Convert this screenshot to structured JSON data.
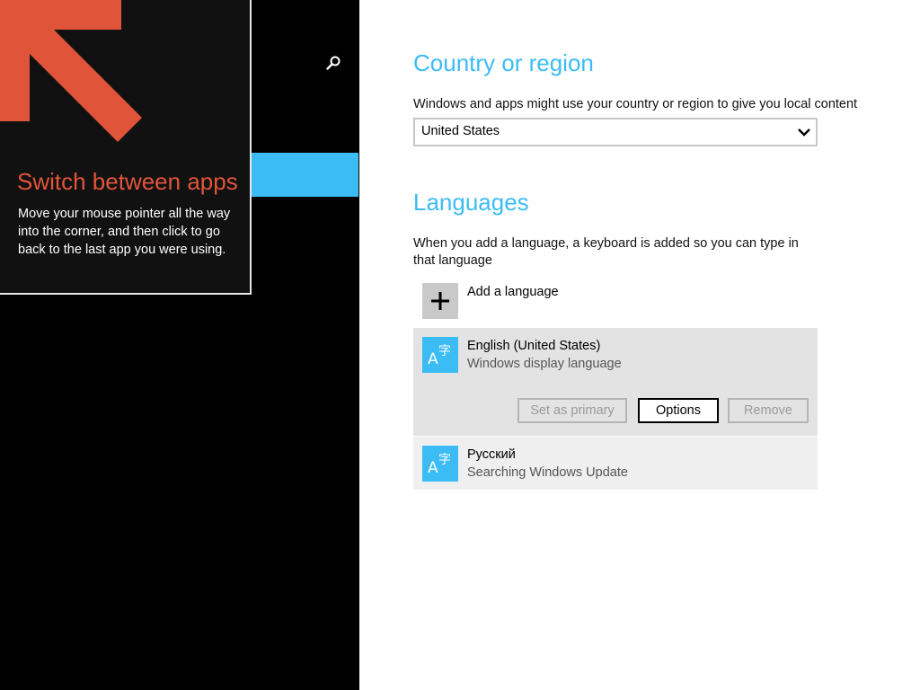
{
  "tip": {
    "title": "Switch between apps",
    "body": "Move your mouse pointer all the way into the corner, and then click to go back to the last app you were using."
  },
  "colors": {
    "accent": "#3bbcf5",
    "tip_title": "#e0553a",
    "tip_arrow": "#e0553a"
  },
  "country_section": {
    "heading": "Country or region",
    "description": "Windows and apps might use your country or region to give you local content",
    "selected_value": "United States"
  },
  "languages_section": {
    "heading": "Languages",
    "description": "When you add a language, a keyboard is added so you can type in that language",
    "add_label": "Add a language",
    "items": [
      {
        "name": "English (United States)",
        "status": "Windows display language",
        "icon": "language-icon",
        "buttons": {
          "set_primary": "Set as primary",
          "options": "Options",
          "remove": "Remove"
        }
      },
      {
        "name": "Русский",
        "status": "Searching Windows Update",
        "icon": "language-icon"
      }
    ]
  }
}
